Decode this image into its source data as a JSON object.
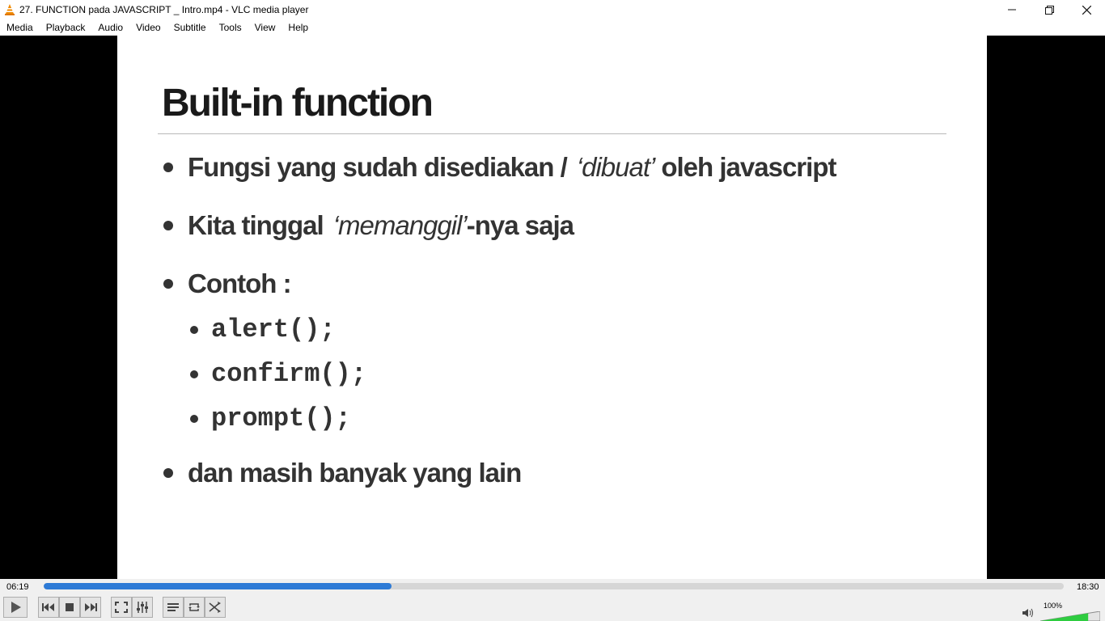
{
  "window": {
    "title": "27. FUNCTION pada JAVASCRIPT _ Intro.mp4 - VLC media player",
    "icon": "vlc-cone-icon",
    "controls": [
      "minimize-icon",
      "restore-icon",
      "close-icon"
    ]
  },
  "menu": {
    "items": [
      "Media",
      "Playback",
      "Audio",
      "Video",
      "Subtitle",
      "Tools",
      "View",
      "Help"
    ]
  },
  "slide": {
    "title": "Built-in function",
    "bullets": [
      {
        "pre": "Fungsi yang sudah disediakan /",
        "italic": "‘dibuat’",
        "post": "oleh javascript"
      },
      {
        "pre": "Kita tinggal",
        "italic": "‘memanggil’",
        "post": "-nya saja"
      },
      {
        "pre": "Contoh :",
        "italic": "",
        "post": ""
      }
    ],
    "code_items": [
      "alert();",
      "confirm();",
      "prompt();"
    ],
    "last_bullet": "dan masih banyak yang lain"
  },
  "player": {
    "elapsed": "06:19",
    "total": "18:30",
    "progress_fraction": 0.341,
    "volume": "100%",
    "volume_fraction": 0.8,
    "accent_color": "#2d7ad6",
    "volume_color": "#2ecc40",
    "buttons": [
      "play-icon",
      "previous-icon",
      "stop-icon",
      "next-icon",
      "fullscreen-icon",
      "extended-settings-icon",
      "playlist-icon",
      "loop-icon",
      "shuffle-icon"
    ]
  }
}
